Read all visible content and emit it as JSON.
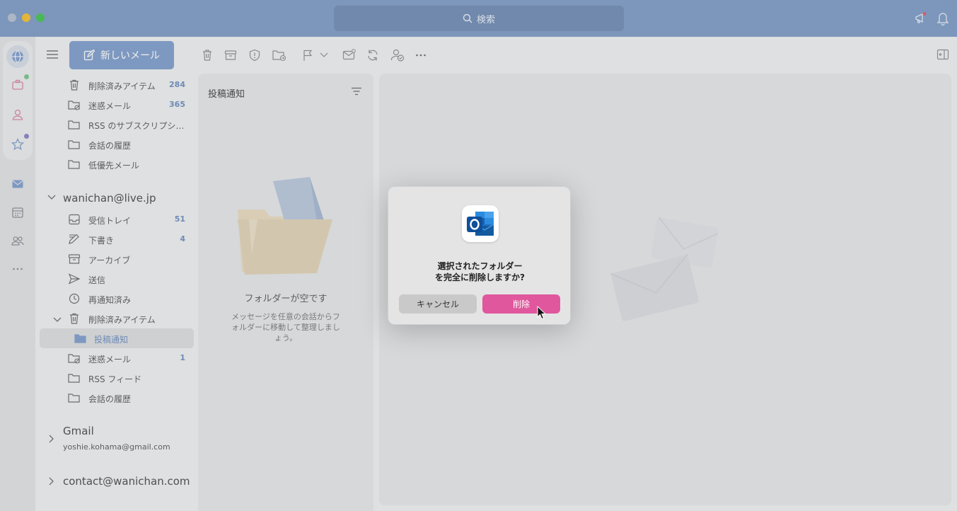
{
  "titlebar": {
    "search_label": "検索"
  },
  "toolbar": {
    "new_mail_label": "新しいメール"
  },
  "folders": {
    "top": [
      {
        "label": "削除済みアイテム",
        "count": "284",
        "icon": "trash-icon"
      },
      {
        "label": "迷惑メール",
        "count": "365",
        "icon": "junk-icon"
      },
      {
        "label": "RSS のサブスクリプシ…",
        "count": "",
        "icon": "folder-icon"
      },
      {
        "label": "会話の履歴",
        "count": "",
        "icon": "folder-icon"
      },
      {
        "label": "低優先メール",
        "count": "",
        "icon": "folder-icon"
      }
    ],
    "account1": {
      "name": "wanichan@live.jp",
      "items": [
        {
          "label": "受信トレイ",
          "count": "51",
          "icon": "inbox-icon"
        },
        {
          "label": "下書き",
          "count": "4",
          "icon": "draft-icon"
        },
        {
          "label": "アーカイブ",
          "count": "",
          "icon": "archive-icon"
        },
        {
          "label": "送信",
          "count": "",
          "icon": "send-icon"
        },
        {
          "label": "再通知済み",
          "count": "",
          "icon": "clock-icon"
        },
        {
          "label": "削除済みアイテム",
          "count": "",
          "icon": "trash-icon"
        },
        {
          "label": "投稿通知",
          "count": "",
          "icon": "folder-icon"
        },
        {
          "label": "迷惑メール",
          "count": "1",
          "icon": "junk-icon"
        },
        {
          "label": "RSS フィード",
          "count": "",
          "icon": "folder-icon"
        },
        {
          "label": "会話の履歴",
          "count": "",
          "icon": "folder-icon"
        }
      ]
    },
    "account2": {
      "name": "Gmail",
      "email": "yoshie.kohama@gmail.com"
    },
    "account3": {
      "name": "contact@wanichan.com"
    }
  },
  "list": {
    "title": "投稿通知",
    "empty_title": "フォルダーが空です",
    "empty_text": "メッセージを任意の会話からフォルダーに移動して整理しましょう。"
  },
  "dialog": {
    "message_line1": "選択されたフォルダー",
    "message_line2": "を完全に削除しますか?",
    "cancel_label": "キャンセル",
    "delete_label": "削除"
  },
  "colors": {
    "titlebar": "#7d9bc4",
    "accent": "#7f9ecb",
    "delete_button": "#e0579d",
    "count": "#6d8dbd"
  }
}
